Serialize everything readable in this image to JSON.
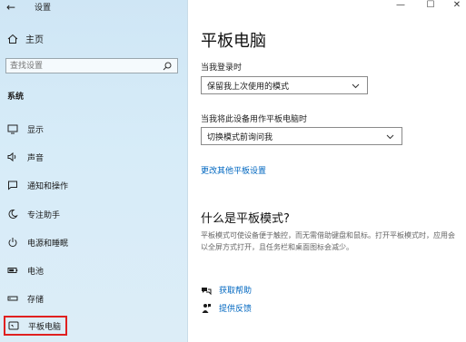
{
  "window": {
    "title": "设置",
    "minimize": "—",
    "maximize": "☐",
    "close": "✕"
  },
  "sidebar": {
    "home_label": "主页",
    "search_placeholder": "查找设置",
    "section_title": "系统",
    "items": [
      {
        "label": "显示",
        "icon": "display-icon"
      },
      {
        "label": "声音",
        "icon": "sound-icon"
      },
      {
        "label": "通知和操作",
        "icon": "notification-icon"
      },
      {
        "label": "专注助手",
        "icon": "focus-assist-icon"
      },
      {
        "label": "电源和睡眠",
        "icon": "power-icon"
      },
      {
        "label": "电池",
        "icon": "battery-icon"
      },
      {
        "label": "存储",
        "icon": "storage-icon"
      },
      {
        "label": "平板电脑",
        "icon": "tablet-icon",
        "selected": true
      }
    ]
  },
  "main": {
    "title": "平板电脑",
    "login_label": "当我登录时",
    "login_value": "保留我上次使用的模式",
    "tablet_label": "当我将此设备用作平板电脑时",
    "tablet_value": "切换模式前询问我",
    "more_settings_link": "更改其他平板设置",
    "what_is_title": "什么是平板模式?",
    "what_is_desc": "平板模式可使设备便于触控，而无需借助键盘和鼠标。打开平板模式时，应用会以全屏方式打开，且任务栏和桌面图标会减少。",
    "get_help": "获取帮助",
    "give_feedback": "提供反馈"
  },
  "colors": {
    "accent": "#0067c0",
    "selection_outline": "#e02020",
    "sidebar_bg": "#d7ecf8"
  }
}
